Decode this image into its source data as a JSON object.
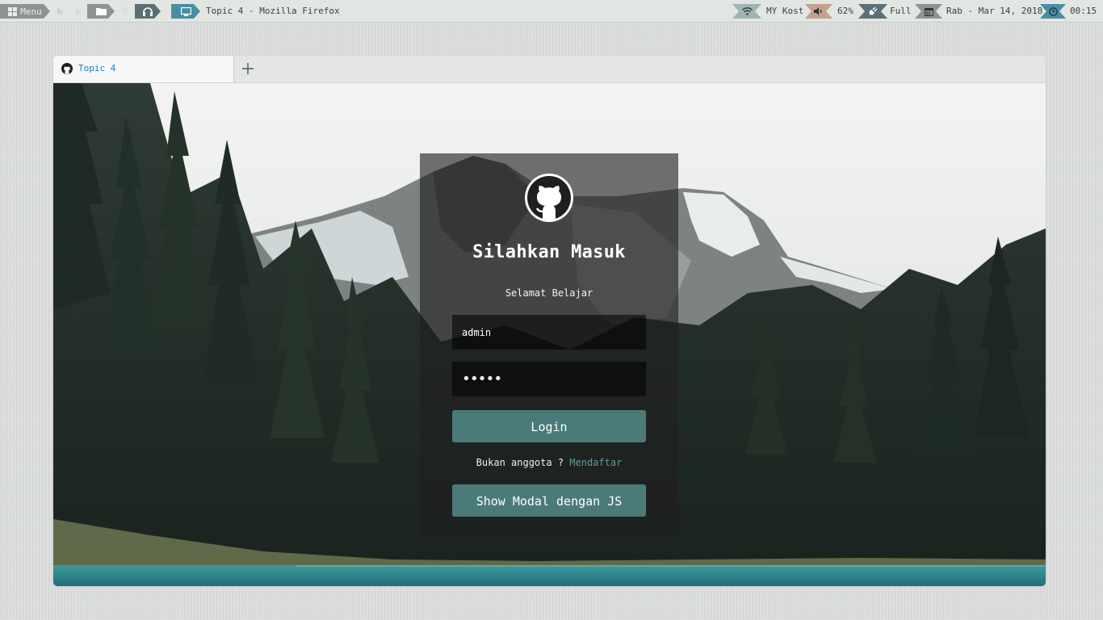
{
  "panel": {
    "menu_label": "Menu",
    "window_title": "Topic 4 - Mozilla Firefox",
    "wifi_name": "MY Kost",
    "volume": "62%",
    "battery": "Full",
    "date": "Rab - Mar 14, 2018",
    "time": "00:15",
    "icons": [
      "grid-icon",
      "refresh-icon",
      "flame-icon",
      "folder-icon",
      "heartbeat-icon",
      "headphones-icon",
      "monitor-icon",
      "wifi-icon",
      "speaker-icon",
      "plug-icon",
      "calendar-icon",
      "clock-icon"
    ]
  },
  "browser": {
    "tab_title": "Topic 4",
    "new_tab_label": "+"
  },
  "login": {
    "title": "Silahkan Masuk",
    "subtitle": "Selamat Belajar",
    "username_value": "admin",
    "password_value": "•••••",
    "login_button": "Login",
    "register_prompt": "Bukan anggota ?",
    "register_link": "Mendaftar",
    "modal_button": "Show Modal dengan JS"
  },
  "colors": {
    "accent_button": "#4b7a7b",
    "link": "#5f9a9c",
    "tab_title": "#1b7cc6",
    "panel_teal": "#4a8ea3"
  }
}
